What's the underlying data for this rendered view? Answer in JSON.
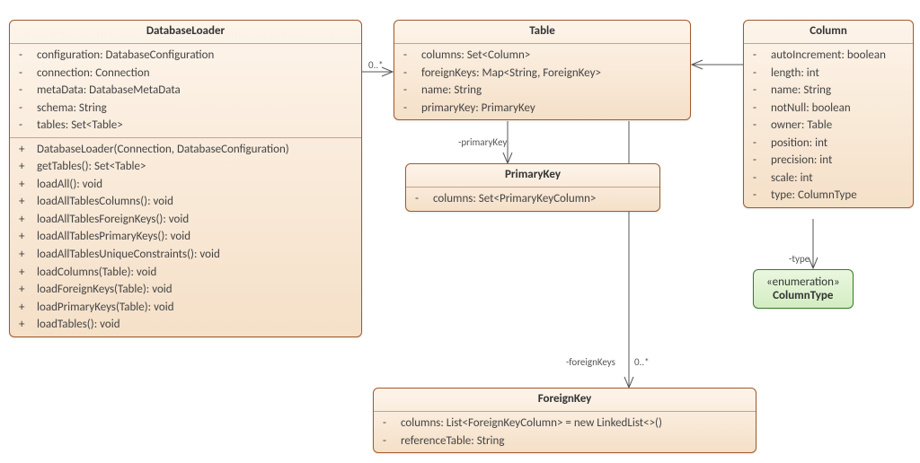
{
  "classes": {
    "databaseLoader": {
      "name": "DatabaseLoader",
      "attributes": [
        {
          "vis": "-",
          "text": "configuration: DatabaseConfiguration"
        },
        {
          "vis": "-",
          "text": "connection: Connection"
        },
        {
          "vis": "-",
          "text": "metaData: DatabaseMetaData"
        },
        {
          "vis": "-",
          "text": "schema: String"
        },
        {
          "vis": "-",
          "text": "tables: Set<Table>"
        }
      ],
      "operations": [
        {
          "vis": "+",
          "text": "DatabaseLoader(Connection, DatabaseConfiguration)"
        },
        {
          "vis": "+",
          "text": "getTables(): Set<Table>"
        },
        {
          "vis": "+",
          "text": "loadAll(): void"
        },
        {
          "vis": "+",
          "text": "loadAllTablesColumns(): void"
        },
        {
          "vis": "+",
          "text": "loadAllTablesForeignKeys(): void"
        },
        {
          "vis": "+",
          "text": "loadAllTablesPrimaryKeys(): void"
        },
        {
          "vis": "+",
          "text": "loadAllTablesUniqueConstraints(): void"
        },
        {
          "vis": "+",
          "text": "loadColumns(Table): void"
        },
        {
          "vis": "+",
          "text": "loadForeignKeys(Table): void"
        },
        {
          "vis": "+",
          "text": "loadPrimaryKeys(Table): void"
        },
        {
          "vis": "+",
          "text": "loadTables(): void"
        }
      ]
    },
    "table": {
      "name": "Table",
      "attributes": [
        {
          "vis": "-",
          "text": "columns: Set<Column>"
        },
        {
          "vis": "-",
          "text": "foreignKeys: Map<String, ForeignKey>"
        },
        {
          "vis": "-",
          "text": "name: String"
        },
        {
          "vis": "-",
          "text": "primaryKey: PrimaryKey"
        }
      ]
    },
    "column": {
      "name": "Column",
      "attributes": [
        {
          "vis": "-",
          "text": "autoIncrement: boolean"
        },
        {
          "vis": "-",
          "text": "length: int"
        },
        {
          "vis": "-",
          "text": "name: String"
        },
        {
          "vis": "-",
          "text": "notNull: boolean"
        },
        {
          "vis": "-",
          "text": "owner: Table"
        },
        {
          "vis": "-",
          "text": "position: int"
        },
        {
          "vis": "-",
          "text": "precision: int"
        },
        {
          "vis": "-",
          "text": "scale: int"
        },
        {
          "vis": "-",
          "text": "type: ColumnType"
        }
      ]
    },
    "primaryKey": {
      "name": "PrimaryKey",
      "attributes": [
        {
          "vis": "-",
          "text": "columns: Set<PrimaryKeyColumn>"
        }
      ]
    },
    "foreignKey": {
      "name": "ForeignKey",
      "attributes": [
        {
          "vis": "-",
          "text": "columns: List<ForeignKeyColumn> = new LinkedList<>()"
        },
        {
          "vis": "-",
          "text": "referenceTable: String"
        }
      ]
    },
    "columnType": {
      "stereotype": "«enumeration»",
      "name": "ColumnType"
    }
  },
  "labels": {
    "zeroStarLeft": "0..*",
    "zeroStarRight": "0..*",
    "primaryKey": "-primaryKey",
    "foreignKeys": "-foreignKeys",
    "type": "-type"
  }
}
